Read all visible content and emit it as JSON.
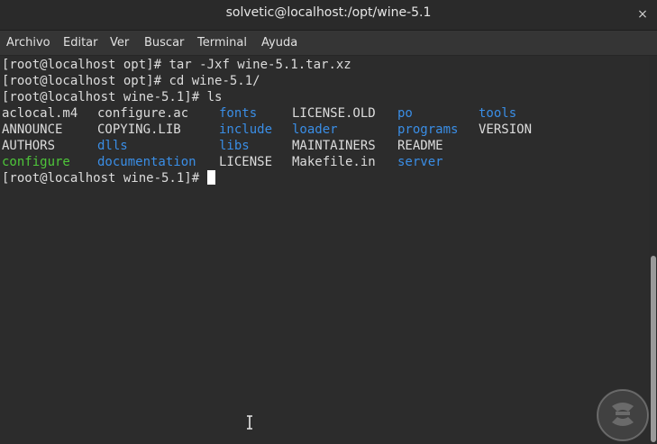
{
  "window": {
    "title": "solvetic@localhost:/opt/wine-5.1",
    "close_icon": "×"
  },
  "menubar": {
    "items": [
      {
        "label": "Archivo"
      },
      {
        "label": "Editar"
      },
      {
        "label": "Ver"
      },
      {
        "label": "Buscar"
      },
      {
        "label": "Terminal"
      },
      {
        "label": "Ayuda"
      }
    ]
  },
  "terminal": {
    "colors": {
      "default": "#dcdcdc",
      "directory": "#3a8ee6",
      "executable": "#4ec63a",
      "background": "#2c2c2c"
    },
    "commands": [
      {
        "prompt": "[root@localhost opt]# ",
        "command": "tar -Jxf wine-5.1.tar.xz"
      },
      {
        "prompt": "[root@localhost opt]# ",
        "command": "cd wine-5.1/"
      },
      {
        "prompt": "[root@localhost wine-5.1]# ",
        "command": "ls"
      }
    ],
    "ls_rows": [
      [
        {
          "text": "aclocal.m4",
          "type": "default"
        },
        {
          "text": "configure.ac",
          "type": "default"
        },
        {
          "text": "fonts",
          "type": "directory"
        },
        {
          "text": "LICENSE.OLD",
          "type": "default"
        },
        {
          "text": "po",
          "type": "directory"
        },
        {
          "text": "tools",
          "type": "directory"
        }
      ],
      [
        {
          "text": "ANNOUNCE",
          "type": "default"
        },
        {
          "text": "COPYING.LIB",
          "type": "default"
        },
        {
          "text": "include",
          "type": "directory"
        },
        {
          "text": "loader",
          "type": "directory"
        },
        {
          "text": "programs",
          "type": "directory"
        },
        {
          "text": "VERSION",
          "type": "default"
        }
      ],
      [
        {
          "text": "AUTHORS",
          "type": "default"
        },
        {
          "text": "dlls",
          "type": "directory"
        },
        {
          "text": "libs",
          "type": "directory"
        },
        {
          "text": "MAINTAINERS",
          "type": "default"
        },
        {
          "text": "README",
          "type": "default"
        },
        {
          "text": "",
          "type": "default"
        }
      ],
      [
        {
          "text": "configure",
          "type": "executable"
        },
        {
          "text": "documentation",
          "type": "directory"
        },
        {
          "text": "LICENSE",
          "type": "default"
        },
        {
          "text": "Makefile.in",
          "type": "default"
        },
        {
          "text": "server",
          "type": "directory"
        },
        {
          "text": "",
          "type": "default"
        }
      ]
    ],
    "current_prompt": "[root@localhost wine-5.1]# "
  },
  "icons": {
    "text_cursor": "i-beam-cursor-icon",
    "watermark": "solvetic-logo-icon"
  }
}
